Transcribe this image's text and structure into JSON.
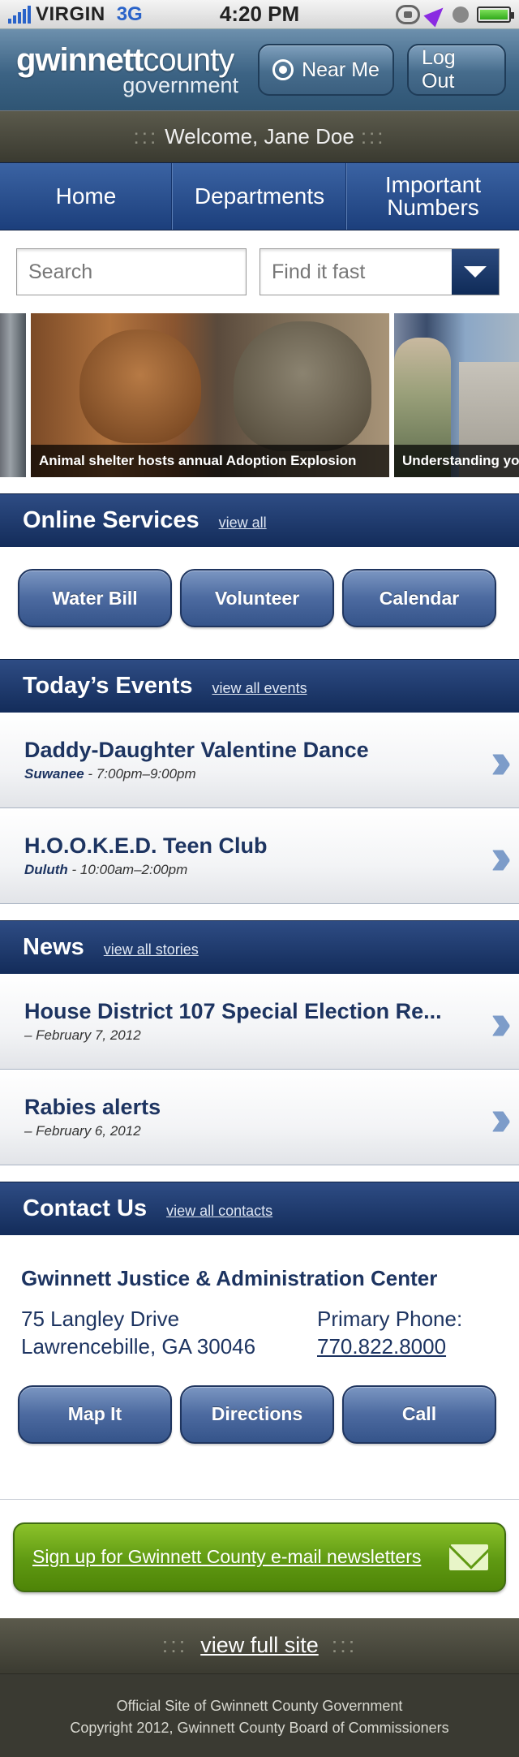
{
  "status_bar": {
    "carrier": "VIRGIN",
    "network": "3G",
    "time": "4:20 PM"
  },
  "header": {
    "logo_bold": "gwinnett",
    "logo_light": "county",
    "logo_line2": "government",
    "near_me_label": "Near Me",
    "logout_label": "Log Out"
  },
  "welcome": {
    "dots_left": ":::",
    "text": "Welcome, Jane Doe",
    "dots_right": ":::"
  },
  "nav": {
    "items": [
      {
        "label": "Home"
      },
      {
        "label": "Departments"
      },
      {
        "label": "Important Numbers"
      }
    ]
  },
  "search": {
    "placeholder": "Search",
    "find_it_fast": "Find it fast"
  },
  "carousel": {
    "slides": [
      {
        "caption": "Animal shelter hosts annual Adoption Explosion"
      },
      {
        "caption": "Understanding yo"
      }
    ]
  },
  "online_services": {
    "title": "Online Services",
    "link": "view all",
    "buttons": [
      {
        "label": "Water Bill"
      },
      {
        "label": "Volunteer"
      },
      {
        "label": "Calendar"
      }
    ]
  },
  "events": {
    "title": "Today’s Events",
    "link": "view all events",
    "items": [
      {
        "title": "Daddy-Daughter Valentine Dance",
        "location": "Suwanee",
        "time": " - 7:00pm–9:00pm"
      },
      {
        "title": "H.O.O.K.E.D. Teen Club",
        "location": "Duluth",
        "time": " - 10:00am–2:00pm"
      }
    ]
  },
  "news": {
    "title": "News",
    "link": "view all stories",
    "items": [
      {
        "title": "House District 107 Special Election Re...",
        "date": "– February 7, 2012"
      },
      {
        "title": "Rabies alerts",
        "date": "– February 6, 2012"
      }
    ]
  },
  "contact": {
    "title": "Contact Us",
    "link": "view all contacts",
    "center_name": "Gwinnett Justice & Administration Center",
    "address_line1": "75 Langley Drive",
    "address_line2": "Lawrencebille, GA 30046",
    "phone_label": "Primary Phone:",
    "phone": "770.822.8000",
    "buttons": [
      {
        "label": "Map It"
      },
      {
        "label": "Directions"
      },
      {
        "label": "Call"
      }
    ]
  },
  "newsletter": {
    "label": "Sign up for Gwinnett County e-mail newsletters"
  },
  "full_site": {
    "dots_left": ":::",
    "label": "view full site",
    "dots_right": ":::"
  },
  "footer": {
    "line1": "Official Site of Gwinnett County Government",
    "line2": "Copyright 2012, Gwinnett County Board of Commissioners"
  },
  "colors": {
    "brand_navy": "#1d3461",
    "section_header": "#132c5a",
    "newsletter_green": "#5f9912",
    "chevron_blue": "#7d9cc9"
  }
}
